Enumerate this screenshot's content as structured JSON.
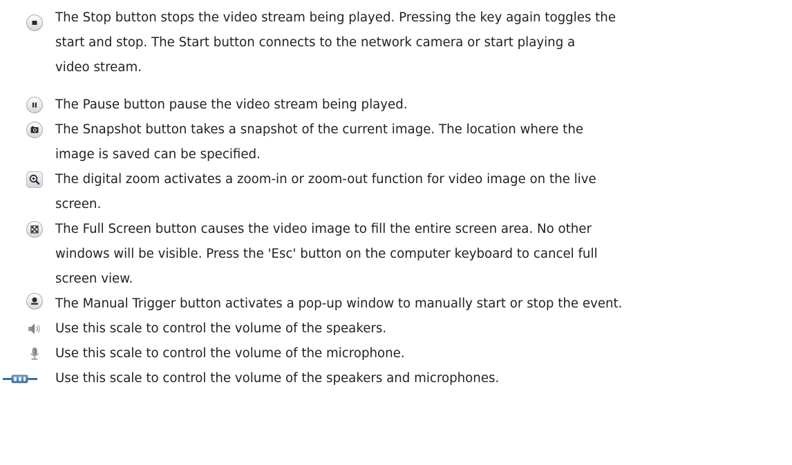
{
  "items": [
    {
      "icon": "stop-icon",
      "lines": [
        "The Stop button stops the video stream being played. Pressing the key again toggles the",
        "start and stop. The Start button connects to the network camera or start playing a",
        "video stream."
      ]
    },
    {
      "icon": "pause-icon",
      "lines": [
        "The Pause button pause the video stream being played."
      ]
    },
    {
      "icon": "snapshot-camera-icon",
      "lines": [
        "The Snapshot button takes a snapshot of the current image. The location where the",
        "image is saved can be specified."
      ]
    },
    {
      "icon": "digital-zoom-icon",
      "lines": [
        "The digital zoom activates a zoom-in or zoom-out function for video image on the live",
        "screen."
      ]
    },
    {
      "icon": "full-screen-icon",
      "lines": [
        "The Full Screen button causes the video image to fill the entire screen area. No other",
        "windows will be visible. Press the 'Esc' button on the computer keyboard to cancel full",
        "screen view."
      ]
    },
    {
      "icon": "manual-trigger-icon",
      "lines": [
        "The Manual Trigger button activates a pop-up window to manually start or stop the event."
      ]
    },
    {
      "icon": "speaker-volume-icon",
      "lines": [
        "Use this scale to control the volume of the speakers."
      ]
    },
    {
      "icon": "microphone-volume-icon",
      "lines": [
        "Use this scale to control the volume of the microphone."
      ]
    },
    {
      "icon": "volume-scale-slider-icon",
      "lines": [
        "Use this scale to control the volume of the speakers and microphones."
      ]
    }
  ]
}
